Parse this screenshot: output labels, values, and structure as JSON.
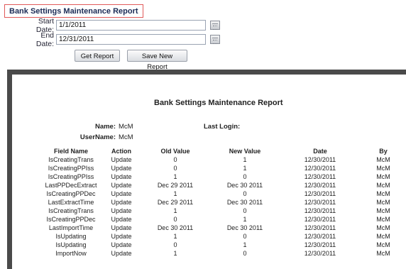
{
  "title": "Bank Settings Maintenance Report",
  "filters": {
    "start_label": "Start Date:",
    "start_value": "1/1/2011",
    "end_label": "End Date:",
    "end_value": "12/31/2011"
  },
  "buttons": {
    "get_report": "Get Report",
    "save_new_report": "Save New Report"
  },
  "report": {
    "title": "Bank Settings Maintenance Report",
    "name_label": "Name:",
    "name_value": "McM",
    "username_label": "UserName:",
    "username_value": "McM",
    "last_login_label": "Last Login:",
    "columns": [
      "Field Name",
      "Action",
      "Old Value",
      "New Value",
      "Date",
      "By"
    ],
    "rows": [
      [
        "IsCreatingTrans",
        "Update",
        "0",
        "1",
        "12/30/2011",
        "McM"
      ],
      [
        "IsCreatingPPIss",
        "Update",
        "0",
        "1",
        "12/30/2011",
        "McM"
      ],
      [
        "IsCreatingPPIss",
        "Update",
        "1",
        "0",
        "12/30/2011",
        "McM"
      ],
      [
        "LastPPDecExtract",
        "Update",
        "Dec 29 2011",
        "Dec 30 2011",
        "12/30/2011",
        "McM"
      ],
      [
        "IsCreatingPPDec",
        "Update",
        "1",
        "0",
        "12/30/2011",
        "McM"
      ],
      [
        "LastExtractTime",
        "Update",
        "Dec 29 2011",
        "Dec 30 2011",
        "12/30/2011",
        "McM"
      ],
      [
        "IsCreatingTrans",
        "Update",
        "1",
        "0",
        "12/30/2011",
        "McM"
      ],
      [
        "IsCreatingPPDec",
        "Update",
        "0",
        "1",
        "12/30/2011",
        "McM"
      ],
      [
        "LastImportTime",
        "Update",
        "Dec 30 2011",
        "Dec 30 2011",
        "12/30/2011",
        "McM"
      ],
      [
        "IsUpdating",
        "Update",
        "1",
        "0",
        "12/30/2011",
        "McM"
      ],
      [
        "IsUpdating",
        "Update",
        "0",
        "1",
        "12/30/2011",
        "McM"
      ],
      [
        "ImportNow",
        "Update",
        "1",
        "0",
        "12/30/2011",
        "McM"
      ]
    ]
  },
  "icons": {
    "start_calendar": "calendar-icon",
    "end_calendar": "calendar-icon"
  },
  "colors": {
    "title_border": "#e05a5a",
    "title_text": "#1a2a55"
  }
}
